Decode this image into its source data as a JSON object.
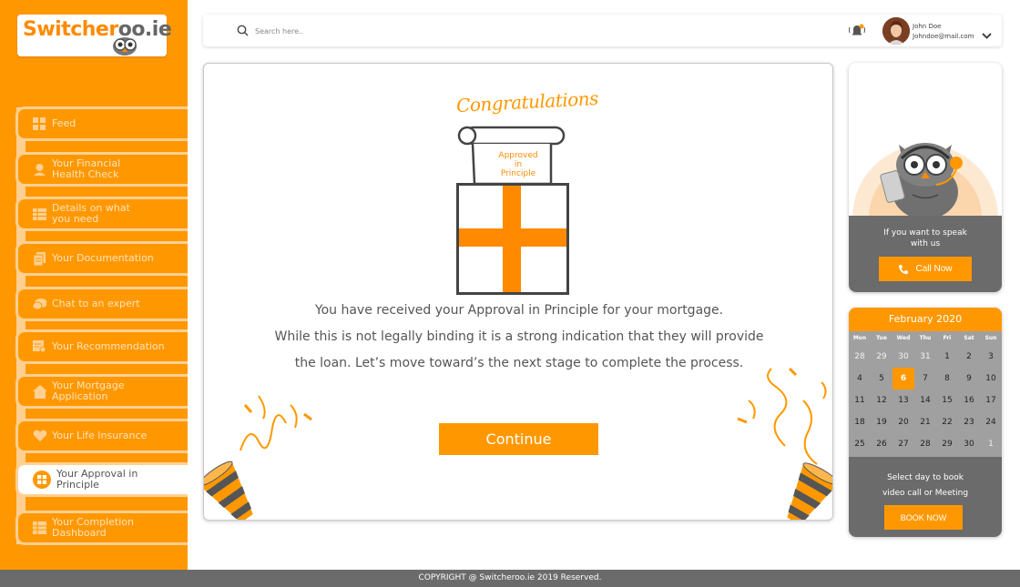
{
  "brand": {
    "logo_part1": "Switcher",
    "logo_part2": "oo.ie",
    "accent": "#ff9800",
    "dark_panel": "#6b6b6b"
  },
  "sidebar": {
    "items": [
      {
        "label": "Feed",
        "icon": "grid-icon"
      },
      {
        "label": "Your Financial Health Check",
        "icon": "health-icon"
      },
      {
        "label": "Details on what you need",
        "icon": "table-icon"
      },
      {
        "label": "Your Documentation",
        "icon": "document-icon"
      },
      {
        "label": "Chat to an expert",
        "icon": "chat-icon"
      },
      {
        "label": "Your Recommendation",
        "icon": "recommendation-icon"
      },
      {
        "label": "Your Mortgage Application",
        "icon": "house-icon"
      },
      {
        "label": "Your Life Insurance",
        "icon": "heart-hand-icon"
      },
      {
        "label": "Your Approval in Principle",
        "icon": "approval-icon",
        "active": true
      },
      {
        "label": "Your Completion Dashboard",
        "icon": "dashboard-icon"
      }
    ]
  },
  "topbar": {
    "search_placeholder": "Search here..",
    "user_name": "John Doe",
    "user_email": "Johndoe@mail.com"
  },
  "main": {
    "congrats": "Congratulations",
    "scroll_text": [
      "Approved",
      "in",
      "Principle"
    ],
    "message_lines": [
      "You have received your Approval in Principle for your mortgage.",
      "While this is not legally binding it is a strong indication that they will provide",
      "the loan. Let’s move toward’s the next stage to complete the process."
    ],
    "continue_label": "Continue"
  },
  "call_card": {
    "text_line1": "If you want to speak",
    "text_line2": "with us",
    "button_label": "Call Now"
  },
  "calendar": {
    "month": "February 2020",
    "weekdays": [
      "Mon",
      "Tue",
      "Wed",
      "Thu",
      "Fri",
      "Sat",
      "Sun"
    ],
    "weeks": [
      [
        "28",
        "29",
        "30",
        "31",
        "1",
        "2",
        "3"
      ],
      [
        "4",
        "5",
        "6",
        "7",
        "8",
        "9",
        "10"
      ],
      [
        "11",
        "12",
        "13",
        "14",
        "15",
        "16",
        "17"
      ],
      [
        "18",
        "19",
        "20",
        "21",
        "22",
        "23",
        "24"
      ],
      [
        "25",
        "26",
        "27",
        "28",
        "29",
        "30",
        "1"
      ]
    ],
    "selected_day": "6",
    "text_line1": "Select day to book",
    "text_line2": "video call or Meeting",
    "button_label": "BOOK NOW"
  },
  "footer": {
    "text": "COPYRIGHT @ Switcheroo.ie 2019 Reserved."
  }
}
